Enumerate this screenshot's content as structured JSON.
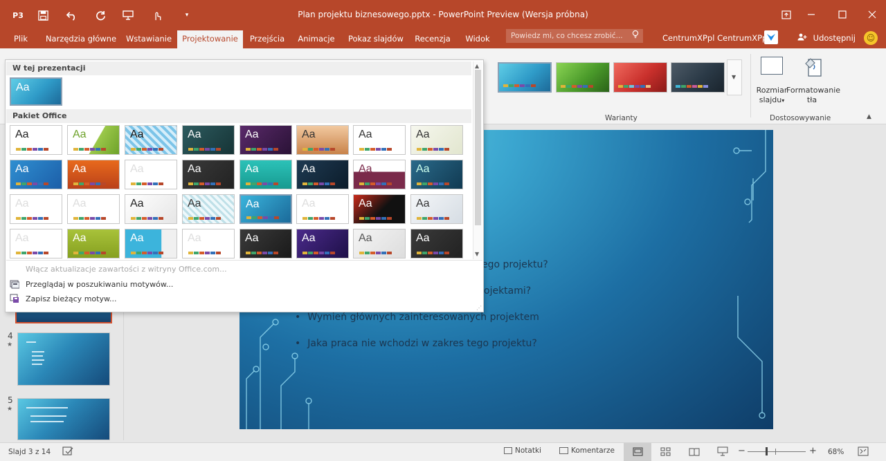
{
  "window": {
    "title": "Plan projektu biznesowego.pptx - PowerPoint Preview (Wersja próbna)",
    "app_badge": "P3"
  },
  "quick_access": {
    "save_icon": "save-icon",
    "undo_icon": "undo-icon",
    "redo_icon": "redo-icon",
    "present_icon": "present-icon",
    "touch_icon": "touch-mode-icon",
    "customize_icon": "customize-icon"
  },
  "tabs": [
    "Plik",
    "Narzędzia główne",
    "Wstawianie",
    "Projektowanie",
    "Przejścia",
    "Animacje",
    "Pokaz slajdów",
    "Recenzja",
    "Widok"
  ],
  "active_tab": "Projektowanie",
  "tell_me": {
    "placeholder": "Powiedz mi, co chcesz zrobić..."
  },
  "user": {
    "name": "CentrumXPpl CentrumXPpl",
    "share": "Udostępnij"
  },
  "ribbon": {
    "variants_label": "Warianty",
    "customize_label": "Dostosowywanie",
    "slide_size_line1": "Rozmiar",
    "slide_size_line2": "slajdu",
    "format_bg_line1": "Formatowanie",
    "format_bg_line2": "tła",
    "variants": [
      {
        "color": "#3fb6d6"
      },
      {
        "color": "#4a9a2a"
      },
      {
        "color": "#c9302c"
      },
      {
        "color": "#2b3a47"
      }
    ]
  },
  "dropdown": {
    "section_current": "W tej prezentacji",
    "section_office": "Pakiet Office",
    "theme_glyph": "Aa",
    "menu": {
      "enable_updates": "Włącz aktualizacje zawartości z witryny Office.com...",
      "browse": "Przeglądaj w poszukiwaniu motywów...",
      "save": "Zapisz bieżący motyw..."
    }
  },
  "slide": {
    "bullets": [
      "ego projektu?",
      "ojektami?",
      "Wymień głównych zainteresowanych projektem",
      "Jaka praca nie wchodzi w zakres tego projektu?"
    ]
  },
  "thumbnails": {
    "items": [
      {
        "num": "4"
      },
      {
        "num": "5"
      }
    ]
  },
  "status": {
    "slide_info": "Slajd 3 z 14",
    "notes": "Notatki",
    "comments": "Komentarze",
    "zoom": "68%"
  }
}
